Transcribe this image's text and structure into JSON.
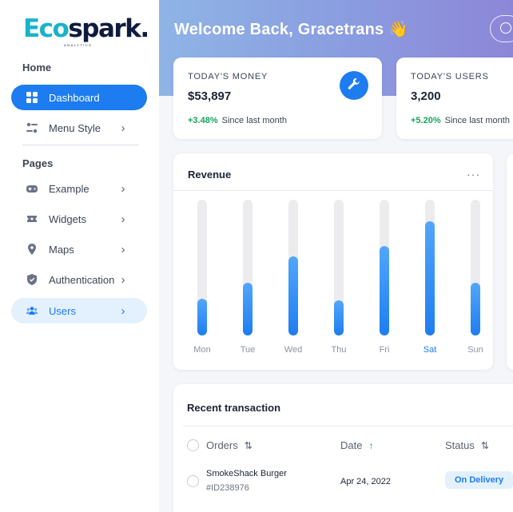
{
  "brand": {
    "logo_part1": "Eco",
    "logo_part2": "spark.",
    "tagline": "ANALYTICS"
  },
  "sidebar": {
    "section_home": "Home",
    "section_pages": "Pages",
    "items": [
      {
        "label": "Dashboard",
        "icon": "dashboard-grid-icon",
        "state": "active",
        "chevron": ""
      },
      {
        "label": "Menu Style",
        "icon": "sliders-icon",
        "state": "",
        "chevron": "›"
      },
      {
        "label": "Example",
        "icon": "gamepad-icon",
        "state": "",
        "chevron": "›"
      },
      {
        "label": "Widgets",
        "icon": "ticket-icon",
        "state": "",
        "chevron": "›"
      },
      {
        "label": "Maps",
        "icon": "map-pin-icon",
        "state": "",
        "chevron": "›"
      },
      {
        "label": "Authentication",
        "icon": "shield-icon",
        "state": "",
        "chevron": "›"
      },
      {
        "label": "Users",
        "icon": "users-icon",
        "state": "selected",
        "chevron": "›"
      }
    ]
  },
  "header": {
    "welcome": "Welcome Back, Gracetrans 👋"
  },
  "stats": [
    {
      "label": "TODAY'S MONEY",
      "value": "$53,897",
      "change": "+3.48%",
      "change_text": "Since last month",
      "icon": "wrench-icon"
    },
    {
      "label": "TODAY'S USERS",
      "value": "3,200",
      "change": "+5.20%",
      "change_text": "Since last month"
    }
  ],
  "revenue": {
    "title": "Revenue",
    "more": "···",
    "highlight_day": "Sat",
    "chart_data": {
      "type": "bar",
      "categories": [
        "Mon",
        "Tue",
        "Wed",
        "Thu",
        "Fri",
        "Sat",
        "Sun"
      ],
      "values": [
        27,
        39,
        58,
        26,
        66,
        84,
        39
      ],
      "ylim": [
        0,
        100
      ],
      "grid": false
    }
  },
  "transactions": {
    "title": "Recent transaction",
    "columns": [
      {
        "label": "Orders",
        "sort": "⇅"
      },
      {
        "label": "Date",
        "sort": "↑"
      },
      {
        "label": "Status",
        "sort": "⇅"
      }
    ],
    "rows": [
      {
        "name": "SmokeShack Burger",
        "id": "#ID238976",
        "date": "Apr 24, 2022",
        "status": "On Delivery"
      }
    ]
  },
  "colors": {
    "primary": "#1d7cf0",
    "success": "#19a35c",
    "brand_teal": "#18b3c9",
    "brand_navy": "#0d1b3e"
  }
}
